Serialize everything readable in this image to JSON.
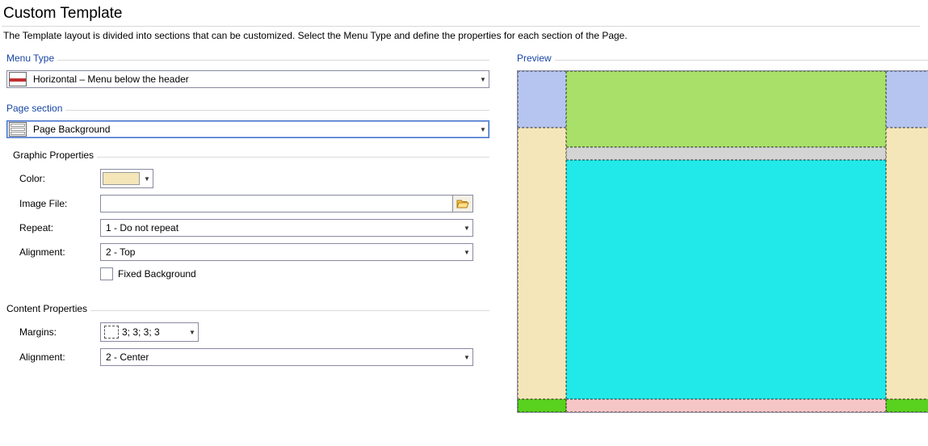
{
  "page": {
    "title": "Custom Template",
    "intro": "The Template layout is divided into sections that can be customized. Select the Menu Type and define the properties for each section of the Page."
  },
  "menuType": {
    "legend": "Menu Type",
    "selected": "Horizontal – Menu below the header"
  },
  "pageSection": {
    "legend": "Page section",
    "selected": "Page Background"
  },
  "graphic": {
    "legend": "Graphic Properties",
    "colorLabel": "Color:",
    "colorValue": "#f4e6b8",
    "imageLabel": "Image File:",
    "imageValue": "",
    "repeatLabel": "Repeat:",
    "repeatValue": "1 - Do not repeat",
    "alignLabel": "Alignment:",
    "alignValue": "2 - Top",
    "fixedLabel": "Fixed Background",
    "fixedChecked": false
  },
  "content": {
    "legend": "Content Properties",
    "marginsLabel": "Margins:",
    "marginsValue": "3; 3; 3; 3",
    "alignLabel": "Alignment:",
    "alignValue": "2 - Center"
  },
  "preview": {
    "legend": "Preview",
    "colors": {
      "background": "#f4e6b8",
      "sideHeader": "#b6c5ef",
      "header": "#a8e06a",
      "menuBar": "#d4d4d4",
      "body": "#22e9e9",
      "footerSide": "#58d21e",
      "footerCenter": "#f6c6c6"
    }
  }
}
